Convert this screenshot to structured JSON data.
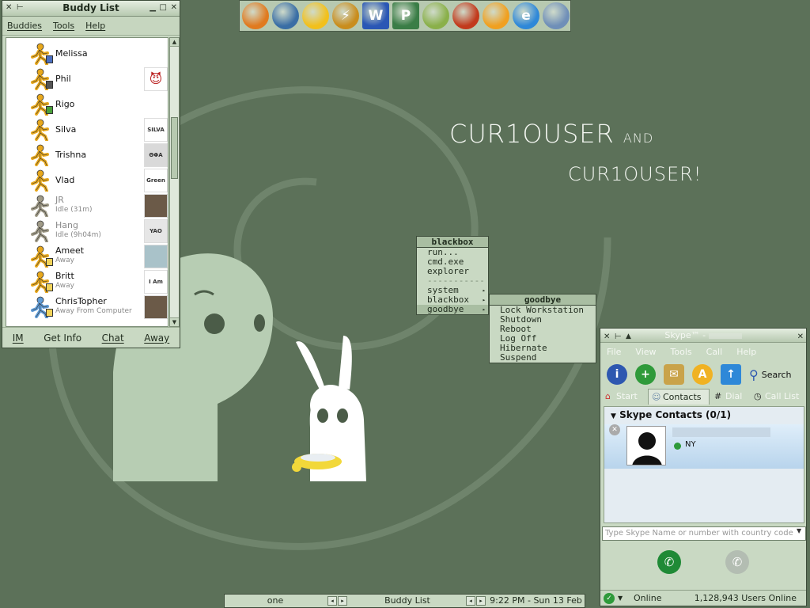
{
  "buddy_list": {
    "title": "Buddy List",
    "menu": [
      "Buddies",
      "Tools",
      "Help"
    ],
    "buddies": [
      {
        "name": "Melissa",
        "status": "",
        "runner": "#e8a81c",
        "badge": "blue",
        "icon": ""
      },
      {
        "name": "Phil",
        "status": "",
        "runner": "#e8a81c",
        "badge": "lock",
        "icon": "devil"
      },
      {
        "name": "Rigo",
        "status": "",
        "runner": "#e8a81c",
        "badge": "green",
        "icon": ""
      },
      {
        "name": "Silva",
        "status": "",
        "runner": "#e8a81c",
        "badge": "",
        "icon": "SILVA"
      },
      {
        "name": "Trishna",
        "status": "",
        "runner": "#e8a81c",
        "badge": "",
        "icon": "ΘΦΑ"
      },
      {
        "name": "Vlad",
        "status": "",
        "runner": "#e8a81c",
        "badge": "",
        "icon": "Green Noodle"
      },
      {
        "name": "JR",
        "status": "Idle (31m)",
        "runner": "#a09b88",
        "badge": "",
        "icon": "photo"
      },
      {
        "name": "Hang",
        "status": "Idle (9h04m)",
        "runner": "#a09b88",
        "badge": "",
        "icon": "YAO"
      },
      {
        "name": "Ameet",
        "status": "Away",
        "runner": "#e8a81c",
        "badge": "note",
        "icon": "dog"
      },
      {
        "name": "Britt",
        "status": "Away",
        "runner": "#e8a81c",
        "badge": "note",
        "icon": "I Am God"
      },
      {
        "name": "ChrisTopher",
        "status": "Away From Computer",
        "runner": "#5f9bd6",
        "badge": "note",
        "icon": "photo"
      }
    ],
    "buttons": [
      "IM",
      "Get Info",
      "Chat",
      "Away"
    ]
  },
  "quicklaunch": [
    {
      "name": "firefox-icon",
      "glyph": "",
      "color": "#e07a1f"
    },
    {
      "name": "thunderbird-icon",
      "glyph": "",
      "color": "#3a6ea5"
    },
    {
      "name": "aim-icon",
      "glyph": "",
      "color": "#f2c01c"
    },
    {
      "name": "winamp-icon",
      "glyph": "⚡",
      "color": "#c98d1d"
    },
    {
      "name": "word-icon",
      "glyph": "W",
      "color": "#2a57b5"
    },
    {
      "name": "project-icon",
      "glyph": "P",
      "color": "#3a7d46"
    },
    {
      "name": "brush-icon",
      "glyph": "",
      "color": "#8ab04a"
    },
    {
      "name": "fire-icon",
      "glyph": "",
      "color": "#c23a1c"
    },
    {
      "name": "orange-dot-icon",
      "glyph": "",
      "color": "#f0a020"
    },
    {
      "name": "ie-icon",
      "glyph": "e",
      "color": "#2f88d8"
    },
    {
      "name": "computer-icon",
      "glyph": "",
      "color": "#6f8fb8"
    }
  ],
  "wallpaper": {
    "word1": "CUR1OUSER",
    "and": "AND",
    "word2": "CUR1OUSER!"
  },
  "blackbox_menu": {
    "title": "blackbox",
    "items": [
      "run...",
      "cmd.exe",
      "explorer"
    ],
    "separator": "-----------",
    "sub_items": [
      "system",
      "blackbox",
      "goodbye"
    ]
  },
  "goodbye_menu": {
    "title": "goodbye",
    "items": [
      "Lock Workstation",
      "Shutdown",
      "Reboot",
      "Log Off",
      "Hibernate",
      "Suspend"
    ]
  },
  "toolbar": {
    "workspace": "one",
    "window": "Buddy List",
    "clock": "9:22 PM - Sun 13 Feb"
  },
  "skype": {
    "title": "Skype™ -",
    "menu": [
      "File",
      "View",
      "Tools",
      "Call",
      "Help"
    ],
    "search_label": "Search",
    "tabs": [
      "Start",
      "Contacts",
      "Dial",
      "Call List"
    ],
    "contacts_header": "Skype Contacts (0/1)",
    "contact_location": "NY",
    "input_placeholder": "Type Skype Name or number with country code",
    "status": "Online",
    "users_online": "1,128,943 Users Online"
  }
}
